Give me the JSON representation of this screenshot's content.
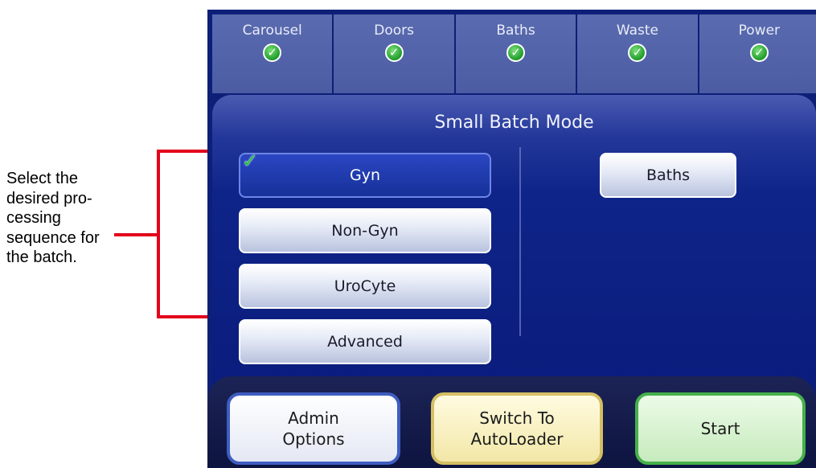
{
  "callout": {
    "lines": [
      "Select the",
      "desired pro-",
      "cessing",
      "sequence for",
      "the batch."
    ]
  },
  "status_bar": [
    {
      "label": "Carousel",
      "icon": "check-circle-icon",
      "ok": true
    },
    {
      "label": "Doors",
      "icon": "check-circle-icon",
      "ok": true
    },
    {
      "label": "Baths",
      "icon": "check-circle-icon",
      "ok": true
    },
    {
      "label": "Waste",
      "icon": "check-circle-icon",
      "ok": true
    },
    {
      "label": "Power",
      "icon": "check-circle-icon",
      "ok": true
    }
  ],
  "mode": {
    "title": "Small Batch Mode",
    "sequences": [
      {
        "label": "Gyn",
        "selected": true
      },
      {
        "label": "Non-Gyn",
        "selected": false
      },
      {
        "label": "UroCyte",
        "selected": false
      },
      {
        "label": "Advanced",
        "selected": false
      }
    ],
    "baths_button": "Baths"
  },
  "actions": {
    "admin_line1": "Admin",
    "admin_line2": "Options",
    "switch_line1": "Switch To",
    "switch_line2": "AutoLoader",
    "start": "Start"
  },
  "colors": {
    "screen_bg": "#0e1f78",
    "callout_line": "#e3001b",
    "check_green": "#1e9b2a",
    "admin_border": "#3f5dc0",
    "switch_border": "#d4bf63",
    "start_border": "#46b04a"
  }
}
